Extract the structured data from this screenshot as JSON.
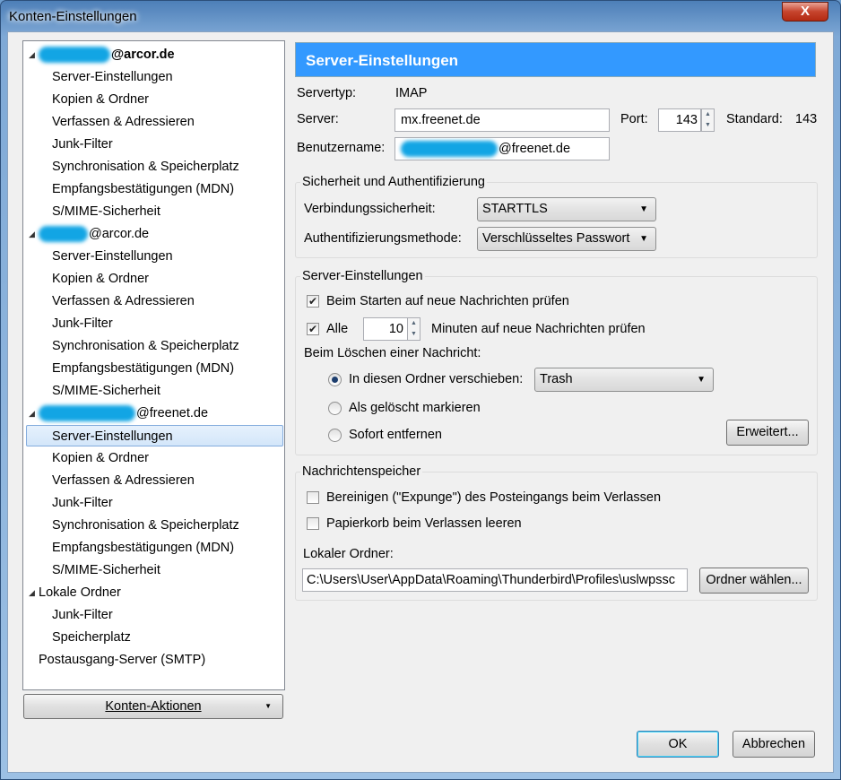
{
  "window": {
    "title": "Konten-Einstellungen",
    "close": "X"
  },
  "tree": {
    "accounts": [
      {
        "label": "@arcor.de",
        "bold": true,
        "children": [
          "Server-Einstellungen",
          "Kopien & Ordner",
          "Verfassen & Adressieren",
          "Junk-Filter",
          "Synchronisation & Speicherplatz",
          "Empfangsbestätigungen (MDN)",
          "S/MIME-Sicherheit"
        ]
      },
      {
        "label": "@arcor.de",
        "children": [
          "Server-Einstellungen",
          "Kopien & Ordner",
          "Verfassen & Adressieren",
          "Junk-Filter",
          "Synchronisation & Speicherplatz",
          "Empfangsbestätigungen (MDN)",
          "S/MIME-Sicherheit"
        ]
      },
      {
        "label": "@freenet.de",
        "children": [
          "Server-Einstellungen",
          "Kopien & Ordner",
          "Verfassen & Adressieren",
          "Junk-Filter",
          "Synchronisation & Speicherplatz",
          "Empfangsbestätigungen (MDN)",
          "S/MIME-Sicherheit"
        ]
      },
      {
        "label": "Lokale Ordner",
        "children": [
          "Junk-Filter",
          "Speicherplatz"
        ]
      }
    ],
    "smtp": "Postausgang-Server (SMTP)",
    "selected": "@freenet.de / Server-Einstellungen"
  },
  "account_actions": "Konten-Aktionen",
  "panel": {
    "title": "Server-Einstellungen",
    "servertype_label": "Servertyp:",
    "servertype": "IMAP",
    "server_label": "Server:",
    "server": "mx.freenet.de",
    "port_label": "Port:",
    "port": "143",
    "standard_label": "Standard:",
    "standard": "143",
    "username_label": "Benutzername:",
    "username": "@freenet.de",
    "security": {
      "legend": "Sicherheit und Authentifizierung",
      "conn_label": "Verbindungssicherheit:",
      "conn": "STARTTLS",
      "auth_label": "Authentifizierungsmethode:",
      "auth": "Verschlüsseltes Passwort"
    },
    "server_settings": {
      "legend": "Server-Einstellungen",
      "check_start": "Beim Starten auf neue Nachrichten prüfen",
      "check_start_on": true,
      "every_label": "Alle",
      "every_on": true,
      "minutes": "10",
      "minutes_label": "Minuten auf neue Nachrichten prüfen",
      "delete_label": "Beim Löschen einer Nachricht:",
      "radio_move": "In diesen Ordner verschieben:",
      "move_folder": "Trash",
      "radio_mark": "Als gelöscht markieren",
      "radio_remove": "Sofort entfernen",
      "selected_radio": "move",
      "advanced": "Erweitert..."
    },
    "storage": {
      "legend": "Nachrichtenspeicher",
      "expunge": "Bereinigen (\"Expunge\") des Posteingangs beim Verlassen",
      "empty_trash": "Papierkorb beim Verlassen leeren",
      "local_label": "Lokaler Ordner:",
      "local_path": "C:\\Users\\User\\AppData\\Roaming\\Thunderbird\\Profiles\\uslwpssc",
      "choose": "Ordner wählen..."
    }
  },
  "buttons": {
    "ok": "OK",
    "cancel": "Abbrechen"
  }
}
